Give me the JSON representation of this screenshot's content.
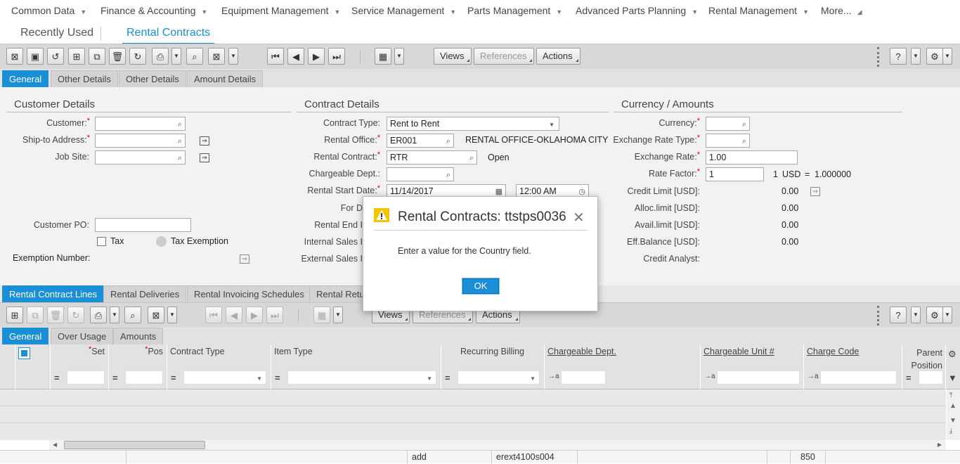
{
  "top_menu": {
    "items": [
      {
        "label": "Common Data"
      },
      {
        "label": "Finance & Accounting"
      },
      {
        "label": "Equipment Management"
      },
      {
        "label": "Service Management"
      },
      {
        "label": "Parts Management"
      },
      {
        "label": "Advanced Parts Planning"
      },
      {
        "label": "Rental Management"
      },
      {
        "label": "More..."
      }
    ]
  },
  "app_tabs": {
    "recent": "Recently Used",
    "active": "Rental Contracts"
  },
  "toolbar": {
    "views": "Views",
    "references": "References",
    "actions": "Actions"
  },
  "header_tabs": [
    "General",
    "Other Details",
    "Other Details",
    "Amount Details"
  ],
  "customer": {
    "heading": "Customer Details",
    "customer_label": "Customer:",
    "ship_to_label": "Ship-to Address:",
    "job_site_label": "Job Site:",
    "customer_po_label": "Customer PO:",
    "tax_label": "Tax",
    "tax_exemption_label": "Tax Exemption",
    "exemption_number_label": "Exemption Number:"
  },
  "contract": {
    "heading": "Contract Details",
    "contract_type_label": "Contract Type:",
    "contract_type_value": "Rent to Rent",
    "rental_office_label": "Rental Office:",
    "rental_office_value": "ER001",
    "rental_office_desc": "RENTAL OFFICE-OKLAHOMA CITY",
    "rental_contract_label": "Rental Contract:",
    "rental_contract_value": "RTR",
    "rental_contract_status": "Open",
    "chargeable_dept_label": "Chargeable Dept.:",
    "rental_start_date_label": "Rental Start Date:",
    "rental_start_date_value": "11/14/2017",
    "rental_start_time_value": "12:00 AM",
    "for_label": "For D",
    "rental_end_label": "Rental End I",
    "internal_sales_label": "Internal Sales I",
    "external_sales_label": "External Sales I"
  },
  "currency": {
    "heading": "Currency / Amounts",
    "currency_label": "Currency:",
    "exchange_rate_type_label": "Exchange Rate Type:",
    "exchange_rate_label": "Exchange Rate:",
    "exchange_rate_value": "1.00",
    "rate_factor_label": "Rate Factor:",
    "rate_factor_value": "1",
    "rate_text_1": "1",
    "rate_text_usd": "USD",
    "rate_text_eq": "=",
    "rate_text_value": "1.000000",
    "credit_limit_label": "Credit Limit [USD]:",
    "credit_limit_value": "0.00",
    "alloc_limit_label": "Alloc.limit [USD]:",
    "alloc_limit_value": "0.00",
    "avail_limit_label": "Avail.limit [USD]:",
    "avail_limit_value": "0.00",
    "eff_balance_label": "Eff.Balance [USD]:",
    "eff_balance_value": "0.00",
    "credit_analyst_label": "Credit Analyst:"
  },
  "lines_tabs": [
    "Rental Contract Lines",
    "Rental Deliveries",
    "Rental Invoicing Schedules",
    "Rental Retu"
  ],
  "lines_toolbar": {
    "views": "Views",
    "references": "References",
    "actions": "Actions"
  },
  "grid_tabs": [
    "General",
    "Over Usage",
    "Amounts"
  ],
  "grid_columns": {
    "set": "Set",
    "pos": "Pos",
    "contract_type": "Contract Type",
    "item_type": "Item Type",
    "recurring_billing": "Recurring Billing",
    "chargeable_dept": "Chargeable Dept.",
    "chargeable_unit": "Chargeable Unit #",
    "charge_code": "Charge Code",
    "parent_position_1": "Parent",
    "parent_position_2": "Position"
  },
  "footer": {
    "cell_1": "add",
    "cell_2": "erext4100s004",
    "cell_3": "850"
  },
  "dialog": {
    "title": "Rental Contracts: ttstps0036",
    "message": "Enter a value for the Country field.",
    "ok": "OK"
  }
}
